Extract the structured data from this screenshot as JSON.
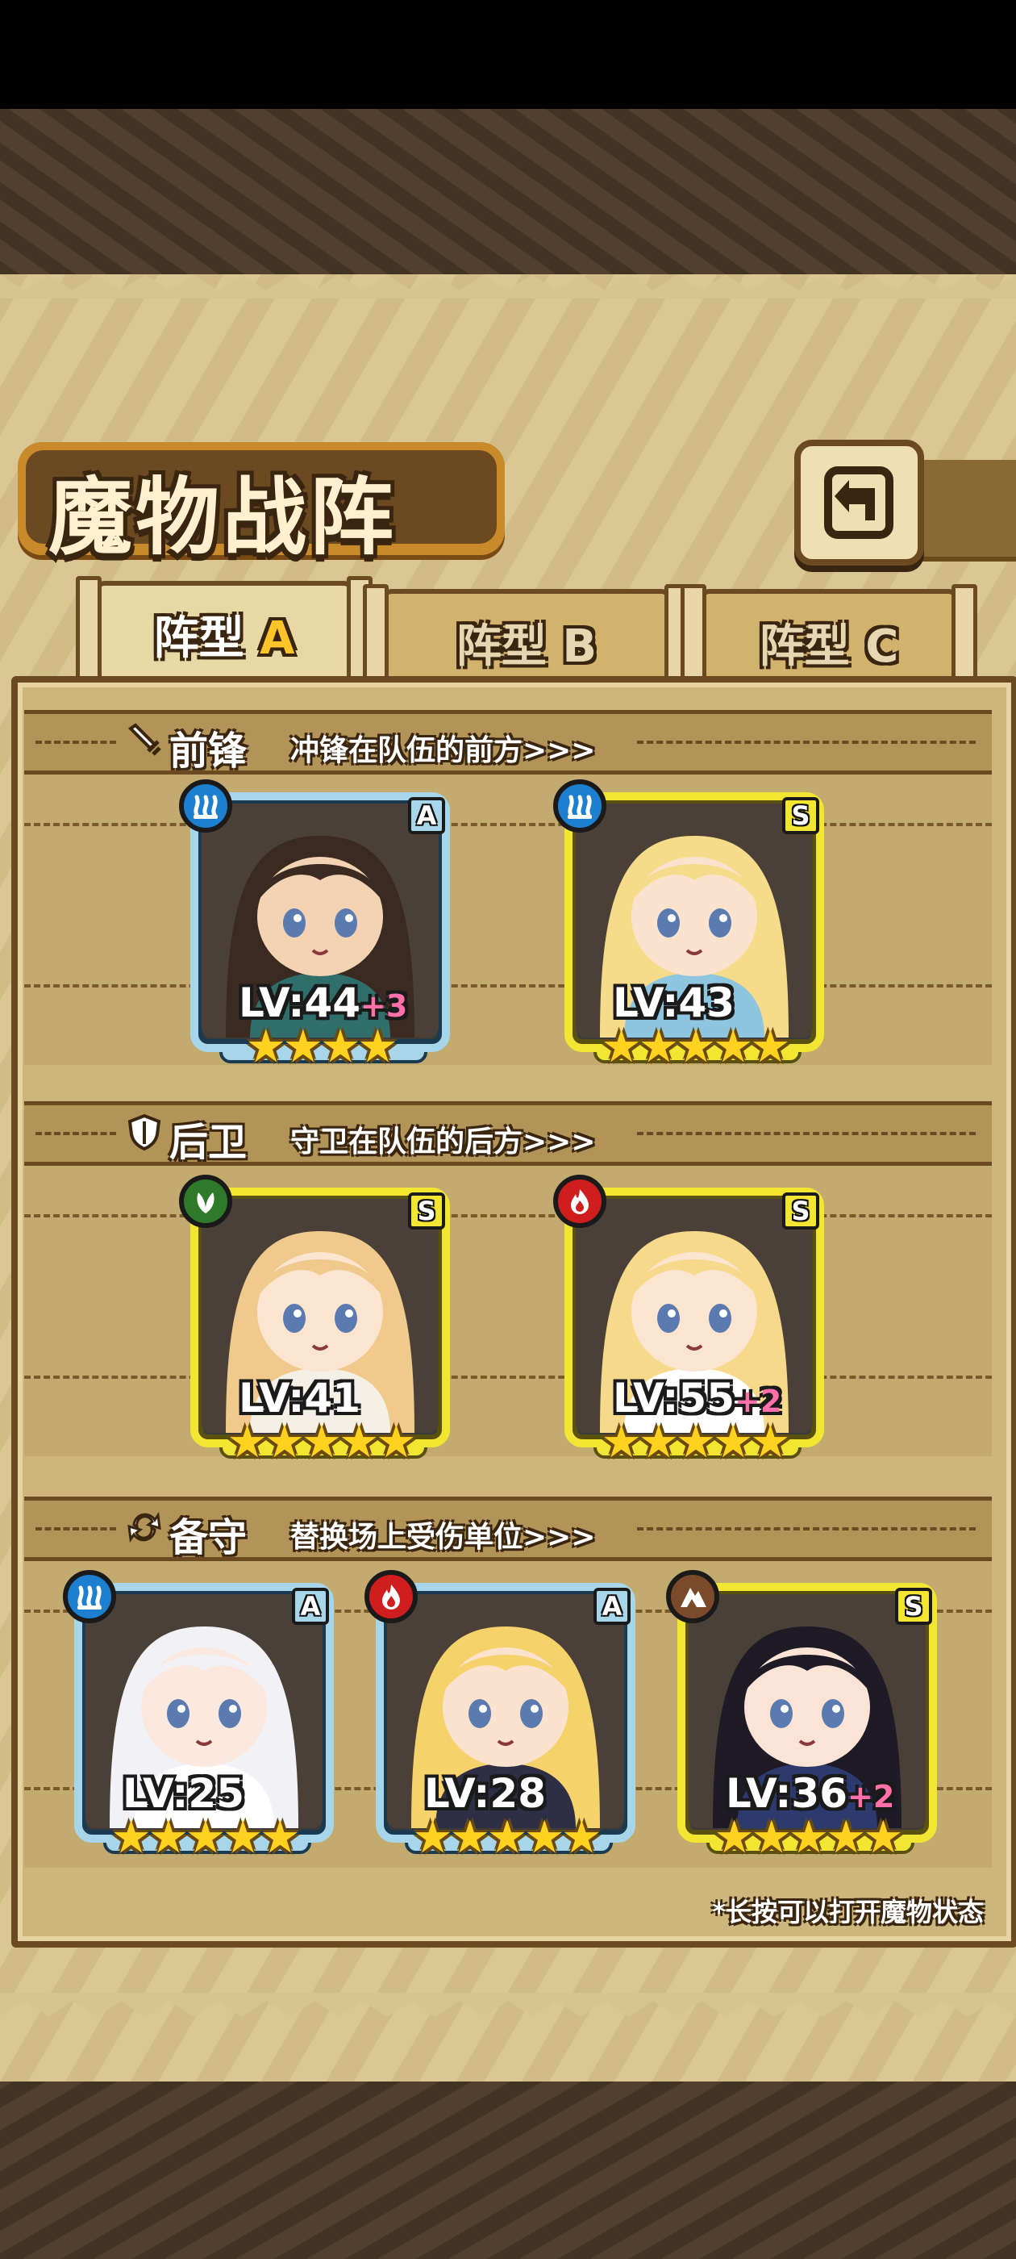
{
  "screen": {
    "title": "魔物战阵",
    "back_icon": "back-arrow-icon",
    "hint": "*长按可以打开魔物状态"
  },
  "tabs": [
    {
      "prefix": "阵型",
      "letter": "A",
      "active": true
    },
    {
      "prefix": "阵型",
      "letter": "B",
      "active": false
    },
    {
      "prefix": "阵型",
      "letter": "C",
      "active": false
    }
  ],
  "sections": {
    "front": {
      "title": "前锋",
      "subtitle": "冲锋在队伍的前方>>>",
      "icon": "sword-icon"
    },
    "back": {
      "title": "后卫",
      "subtitle": "守卫在队伍的后方>>>",
      "icon": "shield-icon"
    },
    "reserve": {
      "title": "备守",
      "subtitle": "替换场上受伤单位>>>",
      "icon": "swap-icon"
    }
  },
  "units": {
    "front": [
      {
        "rank": "A",
        "element": "water",
        "level": "LV:44",
        "bonus": "+3",
        "stars": "★★★★",
        "star_count": 4,
        "hair": "#3a2a22",
        "skin": "#f3d3b4",
        "outfit": "#2f6e6a"
      },
      {
        "rank": "S",
        "element": "water",
        "level": "LV:43",
        "bonus": "",
        "stars": "★★★★★",
        "star_count": 5,
        "hair": "#f6dc8a",
        "skin": "#fbe2cf",
        "outfit": "#8ec6e0"
      }
    ],
    "back": [
      {
        "rank": "S",
        "element": "grass",
        "level": "LV:41",
        "bonus": "",
        "stars": "★★★★★",
        "star_count": 5,
        "hair": "#f0c98c",
        "skin": "#fbe4d0",
        "outfit": "#f4f0e6"
      },
      {
        "rank": "S",
        "element": "fire",
        "level": "LV:55",
        "bonus": "+2",
        "stars": "★★★★★",
        "star_count": 5,
        "hair": "#f6d98a",
        "skin": "#fbe4d0",
        "outfit": "#ffffff"
      }
    ],
    "reserve": [
      {
        "rank": "A",
        "element": "water",
        "level": "LV:25",
        "bonus": "",
        "stars": "★★★★★",
        "star_count": 5,
        "hair": "#f2f2f6",
        "skin": "#fbe8de",
        "outfit": "#ffffff"
      },
      {
        "rank": "A",
        "element": "fire",
        "level": "LV:28",
        "bonus": "",
        "stars": "★★★★★",
        "star_count": 5,
        "hair": "#f6d26a",
        "skin": "#fbe2cf",
        "outfit": "#2e2e44"
      },
      {
        "rank": "S",
        "element": "earth",
        "level": "LV:36",
        "bonus": "+2",
        "stars": "★★★★★",
        "star_count": 5,
        "hair": "#1e1a26",
        "skin": "#fbe4d6",
        "outfit": "#2c3a6e"
      }
    ]
  },
  "element_colors": {
    "water": "#1d7fd0",
    "grass": "#2f7a2a",
    "fire": "#d01d1d",
    "earth": "#7a4a2a"
  }
}
